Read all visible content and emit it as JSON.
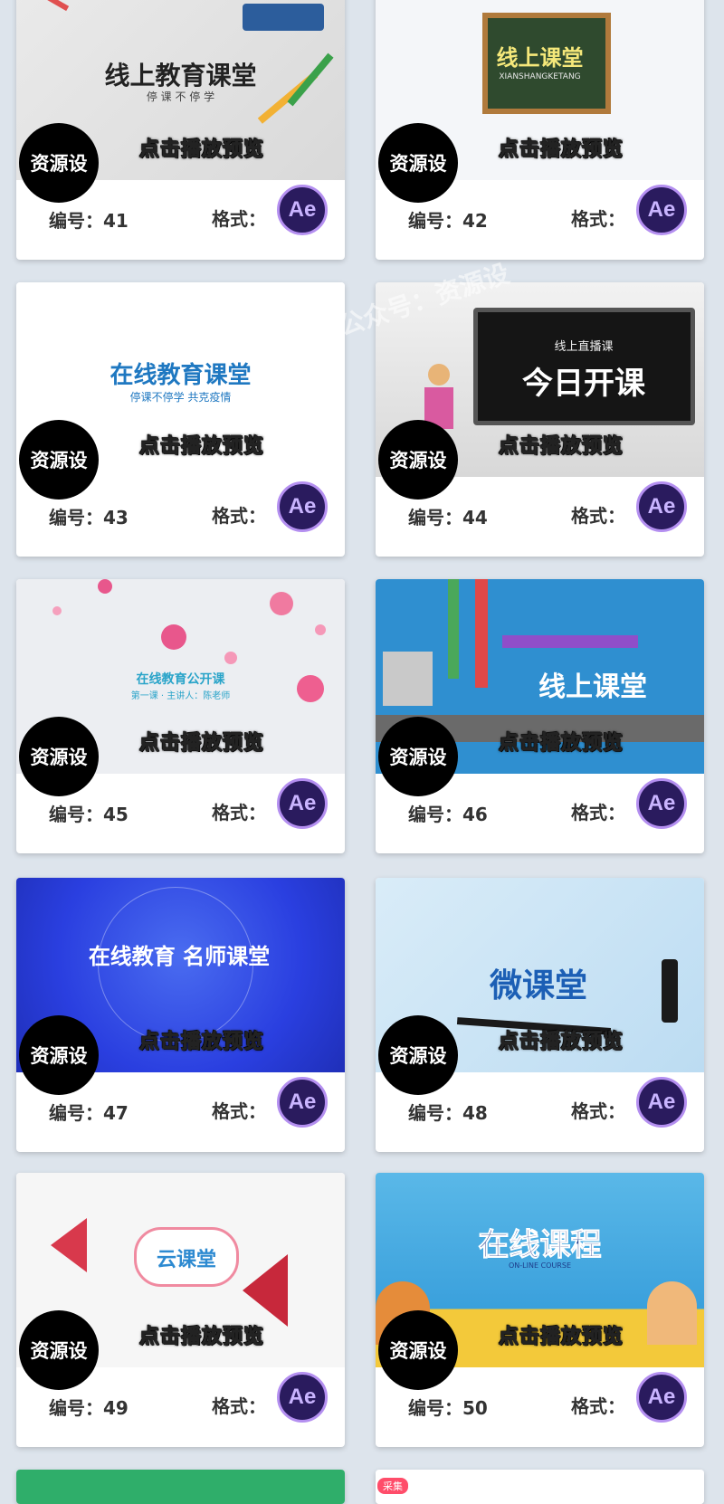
{
  "cards": [
    {
      "thumb_title": "线上教育课堂",
      "thumb_sub": "停 课 不 停 学",
      "play_hint": "点击播放预览",
      "badge": "资源设",
      "number_label": "编号：41",
      "format_label": "格式：",
      "format_icon": "Ae"
    },
    {
      "thumb_title": "线上课堂",
      "thumb_sub": "XIANSHANGKETANG",
      "play_hint": "点击播放预览",
      "badge": "资源设",
      "number_label": "编号：42",
      "format_label": "格式：",
      "format_icon": "Ae"
    },
    {
      "thumb_title": "在线教育课堂",
      "thumb_sub": "停课不停学 共克疫情",
      "play_hint": "点击播放预览",
      "badge": "资源设",
      "number_label": "编号：43",
      "format_label": "格式：",
      "format_icon": "Ae"
    },
    {
      "thumb_title": "今日开课",
      "thumb_sub": "线上直播课",
      "play_hint": "点击播放预览",
      "badge": "资源设",
      "number_label": "编号：44",
      "format_label": "格式：",
      "format_icon": "Ae"
    },
    {
      "thumb_title": "在线教育公开课",
      "thumb_sub": "第一课 · 主讲人：陈老师",
      "play_hint": "点击播放预览",
      "badge": "资源设",
      "number_label": "编号：45",
      "format_label": "格式：",
      "format_icon": "Ae"
    },
    {
      "thumb_title": "线上课堂",
      "thumb_sub": "",
      "play_hint": "点击播放预览",
      "badge": "资源设",
      "number_label": "编号：46",
      "format_label": "格式：",
      "format_icon": "Ae"
    },
    {
      "thumb_title": "在线教育 名师课堂",
      "thumb_sub": "",
      "play_hint": "点击播放预览",
      "badge": "资源设",
      "number_label": "编号：47",
      "format_label": "格式：",
      "format_icon": "Ae"
    },
    {
      "thumb_title": "微课堂",
      "thumb_sub": "",
      "play_hint": "点击播放预览",
      "badge": "资源设",
      "number_label": "编号：48",
      "format_label": "格式：",
      "format_icon": "Ae"
    },
    {
      "thumb_title": "云课堂",
      "thumb_sub": "",
      "play_hint": "点击播放预览",
      "badge": "资源设",
      "number_label": "编号：49",
      "format_label": "格式：",
      "format_icon": "Ae"
    },
    {
      "thumb_title": "在线课程",
      "thumb_sub": "ON-LINE COURSE",
      "play_hint": "点击播放预览",
      "badge": "资源设",
      "number_label": "编号：50",
      "format_label": "格式：",
      "format_icon": "Ae"
    }
  ],
  "watermark": "公众号：资源设",
  "collect_tag": "采集",
  "colors": {
    "background": "#dde4ec",
    "ae_bg": "#2a1b5e",
    "ae_ring": "#b48ff0",
    "badge_bg": "#000000"
  }
}
